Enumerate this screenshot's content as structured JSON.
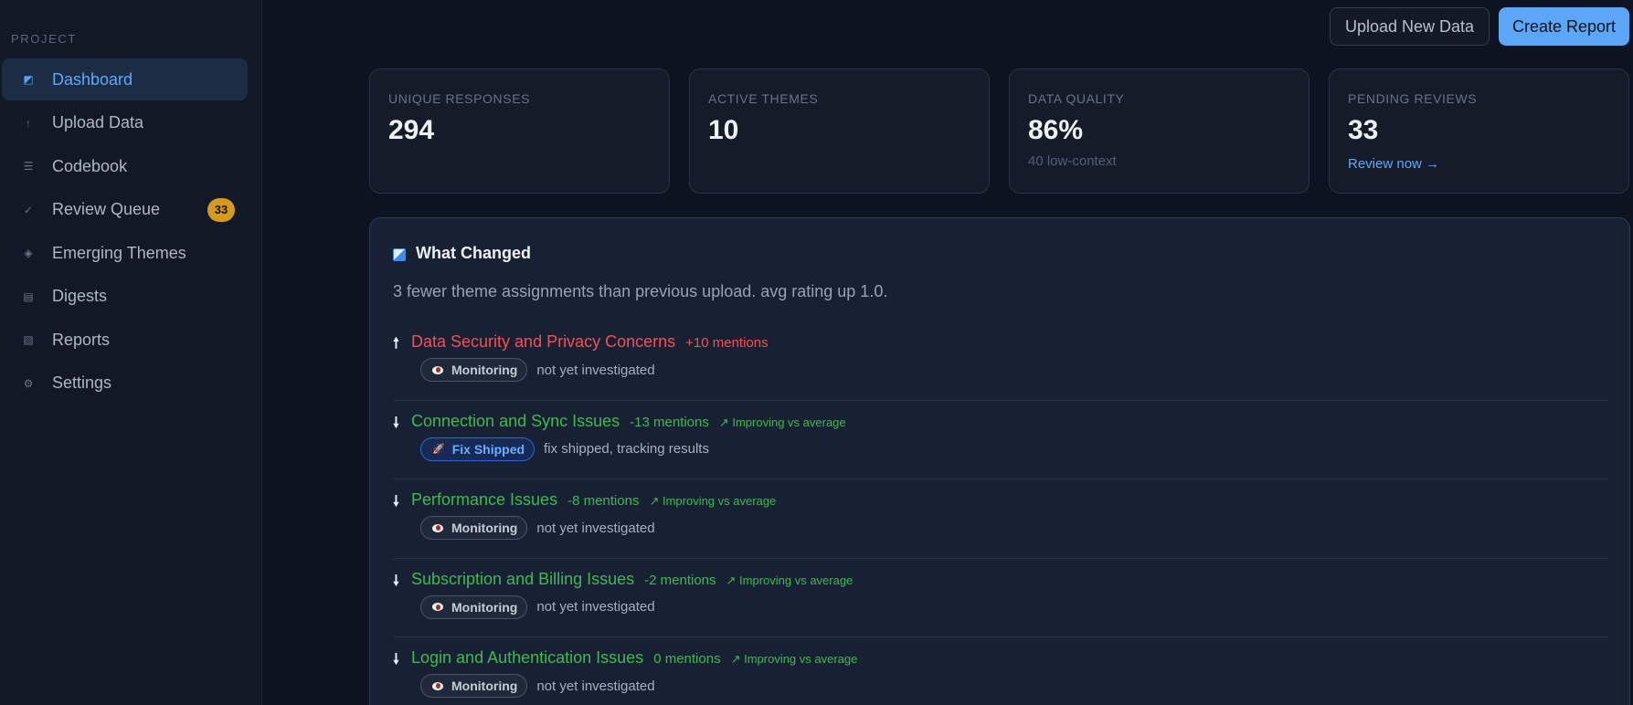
{
  "sidebar": {
    "section_label": "PROJECT",
    "items": [
      {
        "icon": "dashboard-icon",
        "glyph": "◩",
        "label": "Dashboard",
        "active": true
      },
      {
        "icon": "upload-icon",
        "glyph": "↑",
        "label": "Upload Data"
      },
      {
        "icon": "codebook-icon",
        "glyph": "☰",
        "label": "Codebook"
      },
      {
        "icon": "check-icon",
        "glyph": "✓",
        "label": "Review Queue",
        "badge": "33"
      },
      {
        "icon": "diamond-icon",
        "glyph": "◈",
        "label": "Emerging Themes"
      },
      {
        "icon": "digest-icon",
        "glyph": "▤",
        "label": "Digests"
      },
      {
        "icon": "reports-icon",
        "glyph": "▧",
        "label": "Reports"
      },
      {
        "icon": "settings-icon",
        "glyph": "⚙",
        "label": "Settings"
      }
    ]
  },
  "header": {
    "upload_button": "Upload New Data",
    "create_button": "Create Report"
  },
  "stats": [
    {
      "label": "UNIQUE RESPONSES",
      "value": "294"
    },
    {
      "label": "ACTIVE THEMES",
      "value": "10"
    },
    {
      "label": "DATA QUALITY",
      "value": "86%",
      "sub": "40 low-context"
    },
    {
      "label": "PENDING REVIEWS",
      "value": "33",
      "link": "Review now →"
    }
  ],
  "what_changed": {
    "title": "What Changed",
    "summary": "3 fewer theme assignments than previous upload. avg rating up 1.0.",
    "themes": [
      {
        "arrow": "🠕",
        "direction": "up",
        "name": "Data Security and Privacy Concerns",
        "mentions": "+10 mentions",
        "trend": "",
        "status": "Monitoring",
        "status_kind": "monitoring",
        "note": "not yet investigated"
      },
      {
        "arrow": "🠗",
        "direction": "down",
        "name": "Connection and Sync Issues",
        "mentions": "-13 mentions",
        "trend": "↗ Improving vs average",
        "status": "Fix Shipped",
        "status_kind": "shipped",
        "note": "fix shipped, tracking results"
      },
      {
        "arrow": "🠗",
        "direction": "down",
        "name": "Performance Issues",
        "mentions": "-8 mentions",
        "trend": "↗ Improving vs average",
        "status": "Monitoring",
        "status_kind": "monitoring",
        "note": "not yet investigated"
      },
      {
        "arrow": "🠗",
        "direction": "down",
        "name": "Subscription and Billing Issues",
        "mentions": "-2 mentions",
        "trend": "↗ Improving vs average",
        "status": "Monitoring",
        "status_kind": "monitoring",
        "note": "not yet investigated"
      },
      {
        "arrow": "🠗",
        "direction": "down",
        "name": "Login and Authentication Issues",
        "mentions": "0 mentions",
        "trend": "↗ Improving vs average",
        "status": "Monitoring",
        "status_kind": "monitoring",
        "note": "not yet investigated"
      }
    ]
  },
  "colors": {
    "accent": "#5ba6f6",
    "increase": "#f05252",
    "decrease": "#3fb950",
    "badge": "#d49b1d"
  }
}
